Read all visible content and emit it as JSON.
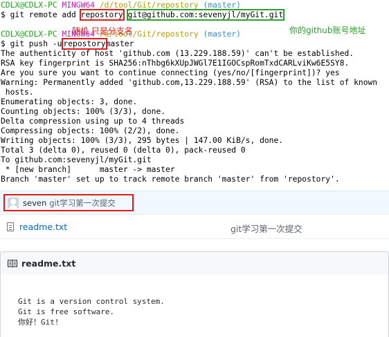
{
  "terminal": {
    "prompt1": {
      "user": "CDLX@CDLX-PC",
      "sys": "MINGW64",
      "path": "/d/tool/Git/repostory",
      "branch": "(master)"
    },
    "cmd1": {
      "prefix": "$ git remote add",
      "remote_name": "repostory",
      "url": "git@github.com:sevenyjl/myGit.git"
    },
    "annotation_red": "随机 只是分支名",
    "annotation_green": "你的github账号地址",
    "prompt2": {
      "user": "CDLX@CDLX-PC",
      "sys": "MINGW64",
      "path": "/d/tool/Git/repostory",
      "branch": "(master)"
    },
    "cmd2": {
      "prefix": "$ git push -u",
      "remote_name": "repostory",
      "suffix": "master"
    },
    "output": [
      "The authenticity of host 'github.com (13.229.188.59)' can't be established.",
      "RSA key fingerprint is SHA256:nThbg6kXUpJWGl7E1IGOCspRomTxdCARLviKw6E5SY8.",
      "Are you sure you want to continue connecting (yes/no/[fingerprint])? yes",
      "Warning: Permanently added 'github.com,13.229.188.59' (RSA) to the list of known",
      " hosts.",
      "Enumerating objects: 3, done.",
      "Counting objects: 100% (3/3), done.",
      "Delta compression using up to 4 threads",
      "Compressing objects: 100% (2/2), done.",
      "Writing objects: 100% (3/3), 295 bytes | 147.00 KiB/s, done.",
      "Total 3 (delta 0), reused 0 (delta 0), pack-reused 0",
      "To github.com:sevenyjl/myGit.git",
      " * [new branch]      master -> master",
      "Branch 'master' set up to track remote branch 'master' from 'repostory'."
    ]
  },
  "commit": {
    "author": "seven",
    "message": "git学习第一次提交"
  },
  "files": [
    {
      "name": "readme.txt",
      "commit_message": "git学习第一次提交"
    }
  ],
  "readme": {
    "title": "readme.txt",
    "lines": [
      "Git is a version control system.",
      "Git is free software.",
      "你好！Git!"
    ]
  },
  "colors": {
    "prompt_user": "#1fa21f",
    "prompt_sys": "#c223c2",
    "prompt_path": "#b3a100",
    "prompt_branch": "#3c8fd6",
    "highlight_red": "#e01b1b",
    "highlight_green": "#2da12d",
    "link": "#0366d6"
  }
}
